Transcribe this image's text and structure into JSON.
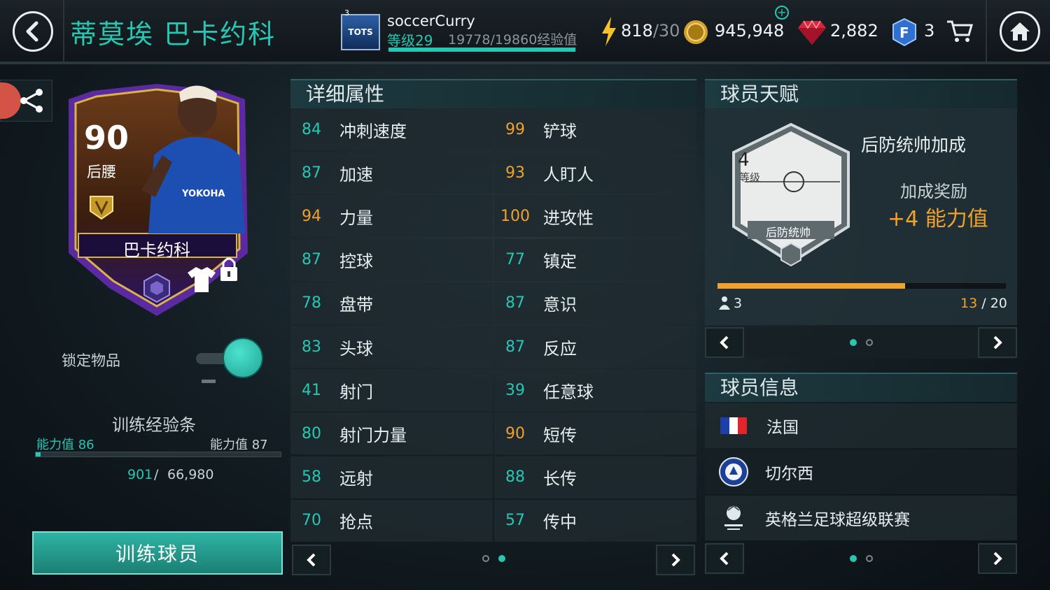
{
  "header": {
    "title": "蒂莫埃 巴卡约科",
    "tots_badge": "TOTS",
    "tots_number": "3",
    "username": "soccerCurry",
    "level_label": "等级29",
    "xp_text": "19778/19860经验值",
    "xp_progress": 0.996,
    "energy_value": "818",
    "energy_max": "/30",
    "coins": "945,948",
    "gems": "2,882",
    "fifa_points": "3"
  },
  "card": {
    "rating": "90",
    "position": "后腰",
    "name": "巴卡约科",
    "team_sponsor": "YOKOHA"
  },
  "left": {
    "lock_label": "锁定物品",
    "lock_on": true,
    "training_title": "训练经验条",
    "ability_left": "能力值 86",
    "ability_right": "能力值 87",
    "training_current": "901",
    "training_sep": "/",
    "training_max": "66,980",
    "training_progress": 0.013,
    "train_button": "训练球员"
  },
  "attributes": {
    "title": "详细属性",
    "left": [
      {
        "value": "84",
        "name": "冲刺速度"
      },
      {
        "value": "87",
        "name": "加速"
      },
      {
        "value": "94",
        "name": "力量"
      },
      {
        "value": "87",
        "name": "控球"
      },
      {
        "value": "78",
        "name": "盘带"
      },
      {
        "value": "83",
        "name": "头球"
      },
      {
        "value": "41",
        "name": "射门"
      },
      {
        "value": "80",
        "name": "射门力量"
      },
      {
        "value": "58",
        "name": "远射"
      },
      {
        "value": "70",
        "name": "抢点"
      }
    ],
    "right": [
      {
        "value": "99",
        "name": "铲球"
      },
      {
        "value": "93",
        "name": "人盯人"
      },
      {
        "value": "100",
        "name": "进攻性"
      },
      {
        "value": "77",
        "name": "镇定"
      },
      {
        "value": "87",
        "name": "意识"
      },
      {
        "value": "87",
        "name": "反应"
      },
      {
        "value": "39",
        "name": "任意球"
      },
      {
        "value": "90",
        "name": "短传"
      },
      {
        "value": "88",
        "name": "长传"
      },
      {
        "value": "57",
        "name": "传中"
      }
    ],
    "page": 2,
    "pages": 2
  },
  "talent": {
    "title": "球员天赋",
    "badge_level": "4",
    "badge_level_label": "等级",
    "badge_name": "后防统帅",
    "name": "后防统帅加成",
    "bonus_label": "加成奖励",
    "bonus_value": "+4 能力值",
    "people": "3",
    "progress_current": "13",
    "progress_sep": "/",
    "progress_max": "20",
    "progress": 0.65,
    "page": 1,
    "pages": 2
  },
  "info": {
    "title": "球员信息",
    "nation": "法国",
    "club": "切尔西",
    "league": "英格兰足球超级联赛",
    "page": 1,
    "pages": 2
  },
  "colors": {
    "accent": "#27c7b3",
    "highlight": "#f2a12b"
  }
}
